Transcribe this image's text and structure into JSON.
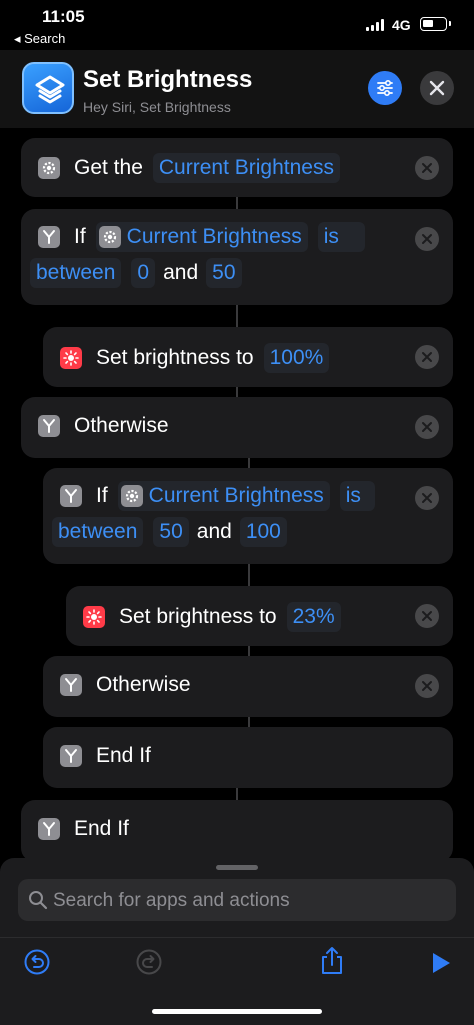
{
  "status_bar": {
    "time": "11:05",
    "back_label": "◂ Search",
    "network": "4G"
  },
  "header": {
    "title": "Set Brightness",
    "subtitle": "Hey Siri, Set Brightness",
    "accent": "#2f7cf6"
  },
  "actions": [
    {
      "kind": "get",
      "prefix": "Get the",
      "variable": "Current Brightness"
    },
    {
      "kind": "if",
      "keyword": "If",
      "variable": "Current Brightness",
      "op1": "is",
      "op2": "between",
      "low": "0",
      "conj": "and",
      "high": "50"
    },
    {
      "kind": "set",
      "label": "Set brightness to",
      "value": "100%"
    },
    {
      "kind": "otherwise",
      "label": "Otherwise"
    },
    {
      "kind": "if",
      "keyword": "If",
      "variable": "Current Brightness",
      "op1": "is",
      "op2": "between",
      "low": "50",
      "conj": "and",
      "high": "100"
    },
    {
      "kind": "set",
      "label": "Set brightness to",
      "value": "23%"
    },
    {
      "kind": "otherwise",
      "label": "Otherwise"
    },
    {
      "kind": "end",
      "label": "End If"
    },
    {
      "kind": "end",
      "label": "End If"
    }
  ],
  "search": {
    "placeholder": "Search for apps and actions"
  },
  "toolbar": {
    "icons": [
      "undo-icon",
      "redo-icon",
      "share-icon",
      "play-icon"
    ]
  },
  "colors": {
    "token_text": "#3d8ff5",
    "card_bg": "#1c1c1e",
    "brightness_icon": "#ff3b48"
  }
}
